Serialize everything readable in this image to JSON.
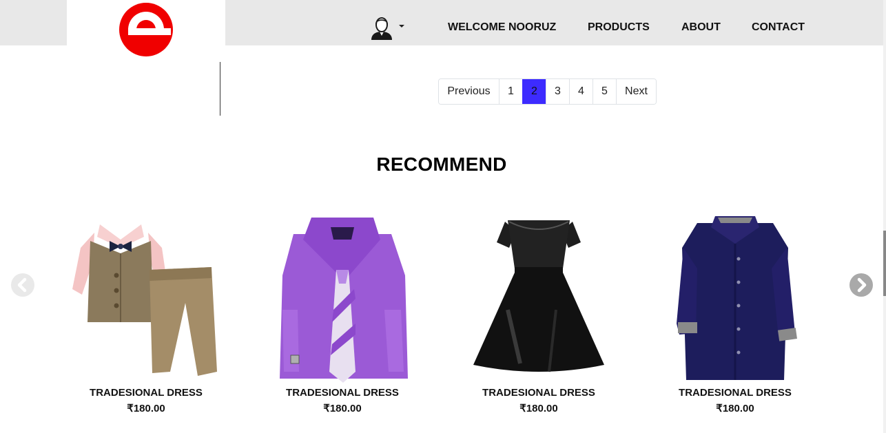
{
  "brand": {
    "logo_icon": "e-logo-icon",
    "logo_color": "#f00000"
  },
  "nav": {
    "user_icon": "user-avatar-icon",
    "welcome": "WELCOME NOORUZ",
    "products": "PRODUCTS",
    "about": "ABOUT",
    "contact": "CONTACT"
  },
  "pagination": {
    "previous": "Previous",
    "pages": [
      "1",
      "2",
      "3",
      "4",
      "5"
    ],
    "active_page": "2",
    "next": "Next",
    "active_color": "#3d2bff"
  },
  "section": {
    "title": "RECOMMEND"
  },
  "carousel": {
    "prev_icon": "chevron-left-icon",
    "next_icon": "chevron-right-icon"
  },
  "products": [
    {
      "name": "TRADESIONAL DRESS",
      "price": "₹180.00",
      "image_icon": "kids-suit-image"
    },
    {
      "name": "TRADESIONAL DRESS",
      "price": "₹180.00",
      "image_icon": "purple-shirt-tie-image"
    },
    {
      "name": "TRADESIONAL DRESS",
      "price": "₹180.00",
      "image_icon": "black-dress-image"
    },
    {
      "name": "TRADESIONAL DRESS",
      "price": "₹180.00",
      "image_icon": "navy-shirt-image"
    }
  ]
}
